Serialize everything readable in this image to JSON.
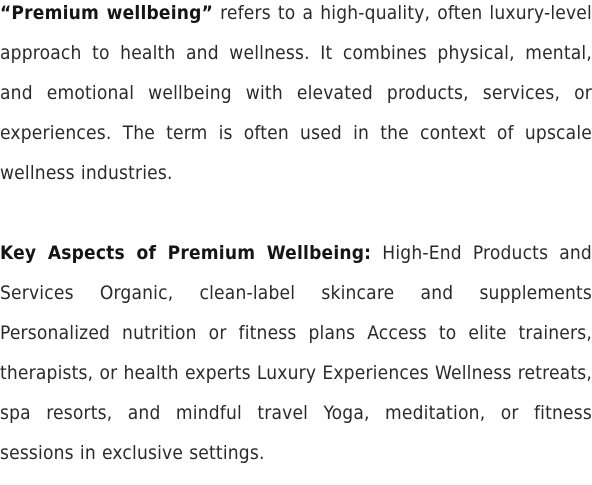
{
  "paragraphs": [
    {
      "lead": "“Premium wellbeing”",
      "body": " refers to a high-quality, often luxury-level approach to health and wellness. It combines physical, mental, and emotional wellbeing with elevated products, services, or experiences. The term is often used in the context of upscale wellness industries."
    },
    {
      "lead": "Key Aspects of Premium Wellbeing:",
      "body": " High-End Products and Services Organic, clean-label skincare and supplements Personalized nutrition or fitness plans Access to elite trainers, therapists, or health experts Luxury Experiences Wellness retreats, spa resorts, and mindful travel Yoga, meditation, or fitness sessions in exclusive settings."
    }
  ]
}
